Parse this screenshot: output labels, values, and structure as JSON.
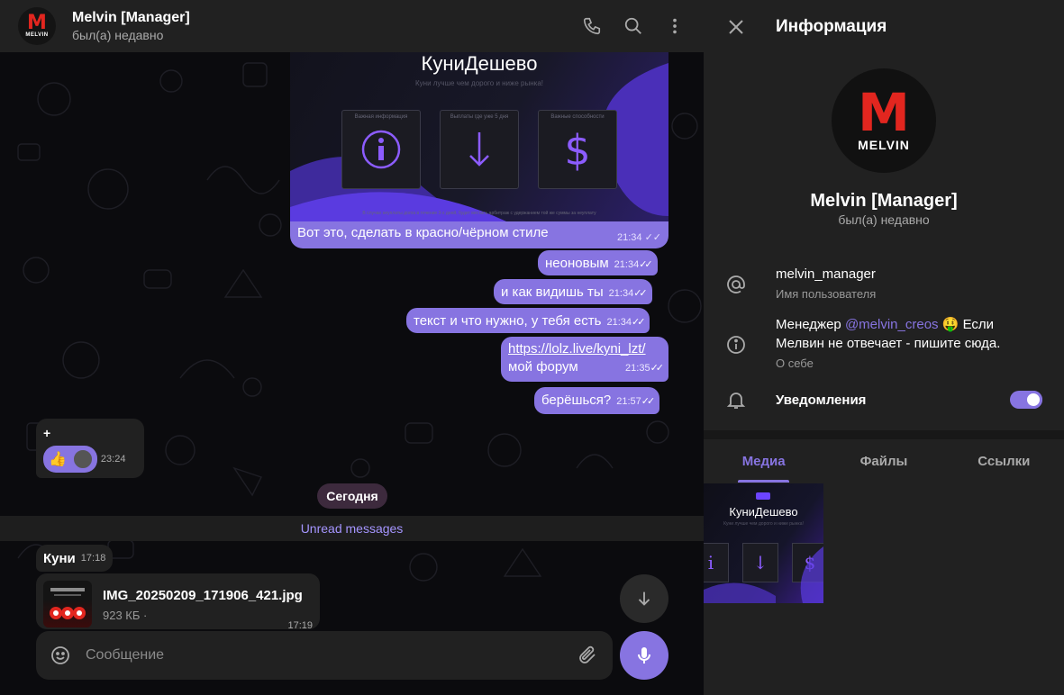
{
  "chat": {
    "header": {
      "title": "Melvin [Manager]",
      "status": "был(а) недавно",
      "avatar_letter": "M",
      "avatar_word": "MELVIN"
    },
    "image_message": {
      "preview_title": "КуниДешево",
      "preview_subtitle": "Куни лучше чем дорого и ниже рынка!",
      "card_captions": [
        "Важная информация",
        "Выплаты где уже 5 дня",
        "Важные способности"
      ],
      "card_icons": [
        "info-icon",
        "arrow-down-icon",
        "dollar-icon"
      ],
      "preview_footer": "В случае неуплаты долга в течение 3-х дней, будет вестись арбитраж с удержанием той же суммы за неуплату",
      "caption": "Вот это, сделать в красно/чёрном стиле",
      "time": "21:34"
    },
    "outgoing": [
      {
        "text": "неоновым",
        "time": "21:34"
      },
      {
        "text": "и как видишь ты",
        "time": "21:34"
      },
      {
        "text": "текст и что нужно, у тебя есть",
        "time": "21:34"
      },
      {
        "link": "https://lolz.live/kyni_lzt/",
        "text": "мой форум",
        "time": "21:35"
      },
      {
        "text": "берёшься?",
        "time": "21:57"
      }
    ],
    "incoming_reaction": {
      "text": "+",
      "emoji": "👍",
      "time": "23:24"
    },
    "date_separator": "Сегодня",
    "unread_label": "Unread messages",
    "incoming_text": {
      "text": "Куни",
      "time": "17:18"
    },
    "file_message": {
      "name": "IMG_20250209_171906_421.jpg",
      "size": "923 КБ ·",
      "time": "17:19"
    },
    "composer": {
      "placeholder": "Сообщение"
    }
  },
  "info": {
    "title": "Информация",
    "name": "Melvin [Manager]",
    "status": "был(а) недавно",
    "avatar_letter": "M",
    "avatar_word": "MELVIN",
    "username": {
      "value": "melvin_manager",
      "label": "Имя пользователя"
    },
    "bio": {
      "prefix": "Менеджер ",
      "mention": "@melvin_creos",
      "emoji": "🤑",
      "rest": " Если Мелвин не отвечает - пишите сюда.",
      "label": "О себе"
    },
    "notifications": {
      "label": "Уведомления",
      "enabled": true
    },
    "tabs": [
      {
        "label": "Медиа",
        "active": true
      },
      {
        "label": "Файлы",
        "active": false
      },
      {
        "label": "Ссылки",
        "active": false
      }
    ],
    "media_thumb_title": "КуниДешево",
    "media_thumb_subtitle": "Куни лучше чем дорого и ниже рынка!"
  },
  "colors": {
    "accent": "#8774e1",
    "panel": "#212121",
    "background": "#0b0b0e",
    "brand_red": "#e2261f"
  }
}
